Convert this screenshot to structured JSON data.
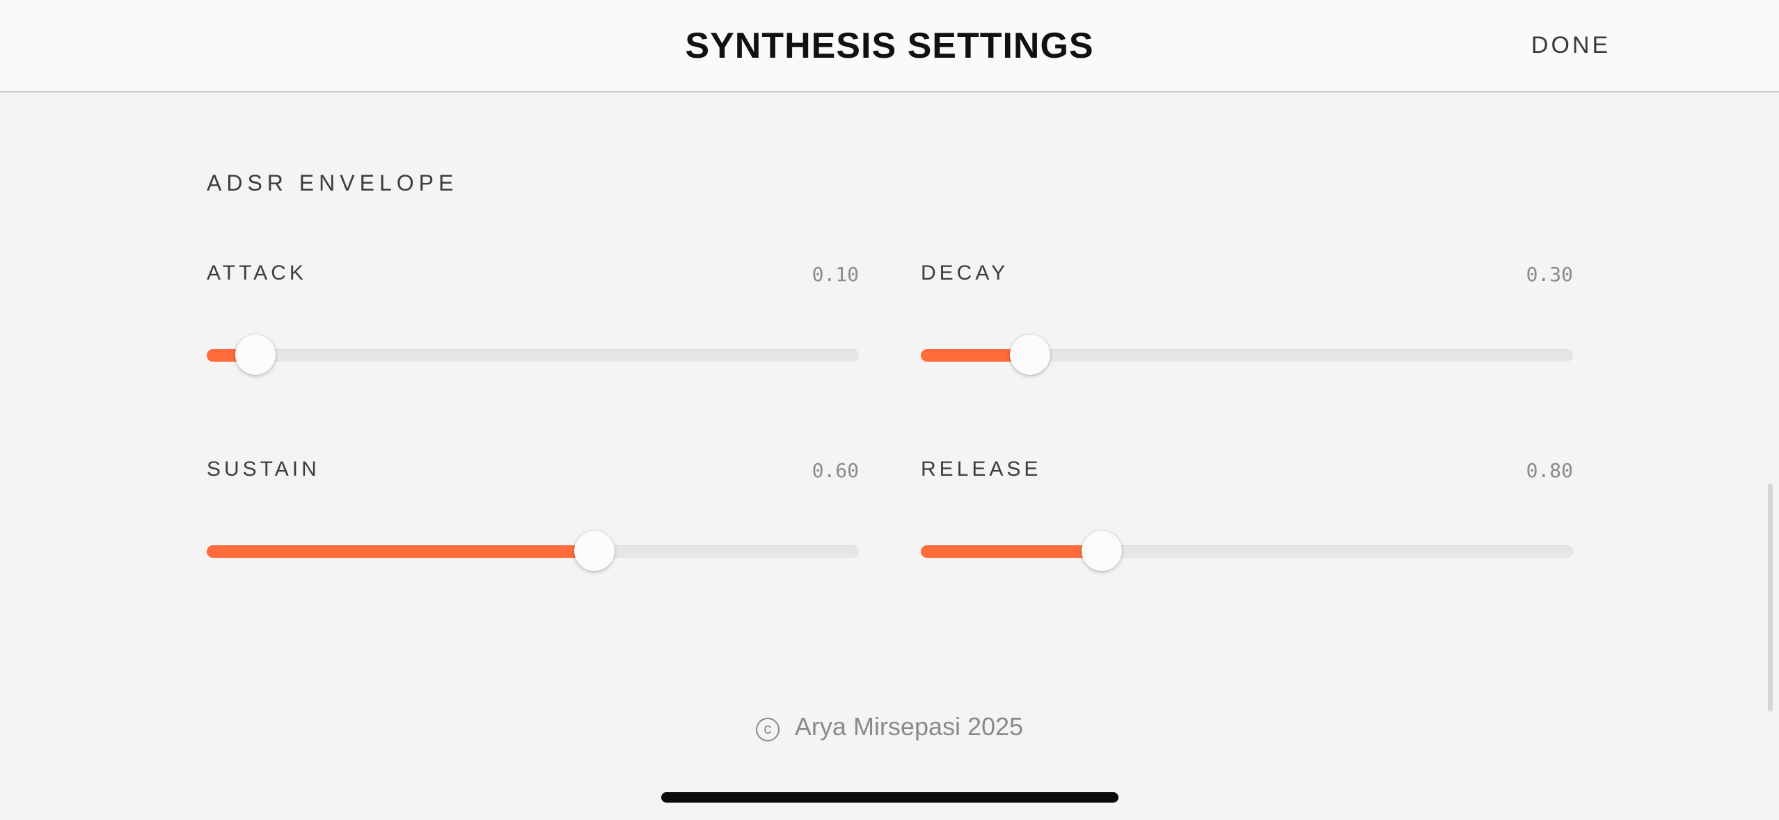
{
  "header": {
    "title": "SYNTHESIS SETTINGS",
    "done_label": "DONE"
  },
  "section": {
    "title": "ADSR ENVELOPE"
  },
  "params": {
    "attack": {
      "label": "ATTACK",
      "value_text": "0.10",
      "fill_fraction": 0.075
    },
    "decay": {
      "label": "DECAY",
      "value_text": "0.30",
      "fill_fraction": 0.168
    },
    "sustain": {
      "label": "SUSTAIN",
      "value_text": "0.60",
      "fill_fraction": 0.594
    },
    "release": {
      "label": "RELEASE",
      "value_text": "0.80",
      "fill_fraction": 0.278
    }
  },
  "footer": {
    "copyright_symbol": "c",
    "text": "Arya Mirsepasi 2025"
  },
  "colors": {
    "accent": "#ff6b3a",
    "track": "#e6e6e6",
    "background": "#f4f4f4"
  }
}
